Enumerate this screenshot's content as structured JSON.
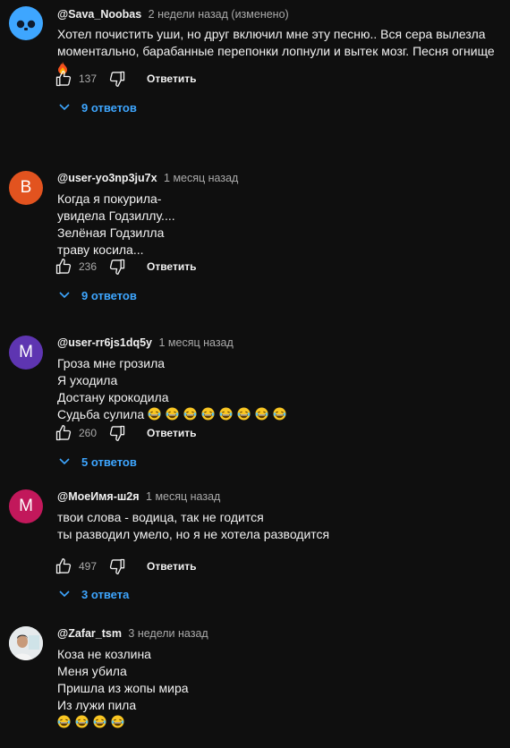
{
  "comments": [
    {
      "author": "@Sava_Noobas",
      "time": "2 недели назад (изменено)",
      "avatar_letter": "",
      "avatar_color": "#3ea6ff",
      "text": "Хотел почистить уши, но друг включил мне эту песню.. Вся сера вылезла моментально, барабанные перепонки лопнули и вытек мозг. Песня огнище",
      "text_suffix_icon": "fire-emoji",
      "likes": "137",
      "reply_label": "Ответить",
      "replies_label": "9 ответов"
    },
    {
      "author": "@user-yo3np3ju7x",
      "time": "1 месяц назад",
      "avatar_letter": "B",
      "avatar_color": "#e2531f",
      "text": "Когда я покурила-\nувидела Годзиллу....\nЗелёная Годзилла\nтраву косила...",
      "likes": "236",
      "reply_label": "Ответить",
      "replies_label": "9 ответов"
    },
    {
      "author": "@user-rr6js1dq5y",
      "time": "1 месяц назад",
      "avatar_letter": "M",
      "avatar_color": "#5e35b1",
      "text": "Гроза мне грозила\nЯ уходила\nДостану крокодила\nСудьба сулила",
      "emoji_name": "laughing-emoji",
      "emoji_count": 8,
      "likes": "260",
      "reply_label": "Ответить",
      "replies_label": "5 ответов"
    },
    {
      "author": "@МоеИмя-ш2я",
      "time": "1 месяц назад",
      "avatar_letter": "M",
      "avatar_color": "#c2185b",
      "text": "твои слова - водица, так не годится\nты разводил умело, но я не хотела разводится",
      "likes": "497",
      "reply_label": "Ответить",
      "replies_label": "3 ответа"
    },
    {
      "author": "@Zafar_tsm",
      "time": "3 недели назад",
      "avatar_letter": "",
      "avatar_color": "#e8ecef",
      "text": "Коза не козлина\nМеня убила\nПришла из жопы мира\nИз лужи пила",
      "emoji_name": "laughing-emoji",
      "emoji_count": 4
    }
  ]
}
